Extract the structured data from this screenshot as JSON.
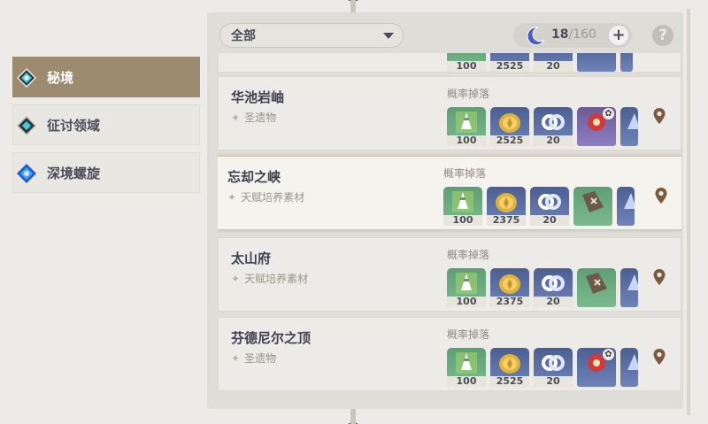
{
  "sidebar": {
    "items": [
      {
        "label": "秘境",
        "icon": "domain-diamond-icon",
        "active": true
      },
      {
        "label": "征讨领域",
        "icon": "trounce-diamond-icon",
        "active": false
      },
      {
        "label": "深境螺旋",
        "icon": "spiral-abyss-icon",
        "active": false
      }
    ]
  },
  "filter": {
    "selected": "全部"
  },
  "resin": {
    "current": "18",
    "max": "/160",
    "plus_label": "+"
  },
  "help_label": "?",
  "drop_label": "概率掉落",
  "top_partial": {
    "qtys": [
      "100",
      "2525",
      "20"
    ]
  },
  "domains": [
    {
      "name": "华池岩岫",
      "category": "圣遗物",
      "drops": [
        {
          "icon": "adventure-exp-icon",
          "qty": "100",
          "color": "green"
        },
        {
          "icon": "mora-icon",
          "qty": "2525",
          "color": "blue"
        },
        {
          "icon": "companionship-exp-icon",
          "qty": "20",
          "color": "blue"
        },
        {
          "icon": "artifact-flower-icon",
          "qty": "",
          "color": "purple",
          "badge": "✿"
        },
        {
          "icon": "artifact-partial-icon",
          "qty": "",
          "color": "blue"
        }
      ]
    },
    {
      "name": "忘却之峡",
      "category": "天赋培养素材",
      "drops": [
        {
          "icon": "adventure-exp-icon",
          "qty": "100",
          "color": "green"
        },
        {
          "icon": "mora-icon",
          "qty": "2375",
          "color": "blue"
        },
        {
          "icon": "companionship-exp-icon",
          "qty": "20",
          "color": "blue"
        },
        {
          "icon": "talent-book-icon",
          "qty": "",
          "color": "green"
        },
        {
          "icon": "talent-book-partial-icon",
          "qty": "",
          "color": "blue"
        }
      ]
    },
    {
      "name": "太山府",
      "category": "天赋培养素材",
      "drops": [
        {
          "icon": "adventure-exp-icon",
          "qty": "100",
          "color": "green"
        },
        {
          "icon": "mora-icon",
          "qty": "2375",
          "color": "blue"
        },
        {
          "icon": "companionship-exp-icon",
          "qty": "20",
          "color": "blue"
        },
        {
          "icon": "talent-book-icon",
          "qty": "",
          "color": "green"
        },
        {
          "icon": "talent-book-partial-icon",
          "qty": "",
          "color": "blue"
        }
      ]
    },
    {
      "name": "芬德尼尔之顶",
      "category": "圣遗物",
      "drops": [
        {
          "icon": "adventure-exp-icon",
          "qty": "100",
          "color": "green"
        },
        {
          "icon": "mora-icon",
          "qty": "2525",
          "color": "blue"
        },
        {
          "icon": "companionship-exp-icon",
          "qty": "20",
          "color": "blue"
        },
        {
          "icon": "artifact-flower-icon",
          "qty": "",
          "color": "blue",
          "badge": "✿"
        },
        {
          "icon": "artifact-partial-icon",
          "qty": "",
          "color": "blue"
        }
      ]
    }
  ]
}
